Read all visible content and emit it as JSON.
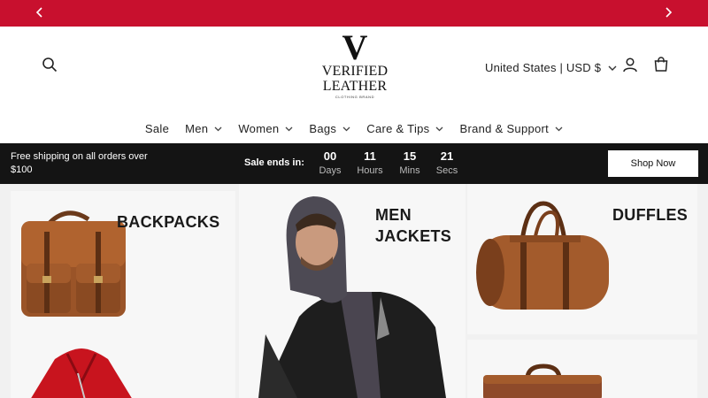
{
  "colors": {
    "announce_bg": "#c8102e",
    "promo_bg": "#141414"
  },
  "announcement": {
    "prev_icon": "chevron-left-icon",
    "next_icon": "chevron-right-icon"
  },
  "header": {
    "logo": {
      "letter": "V",
      "line1": "VERIFIED",
      "line2": "LEATHER",
      "tagline": "CLOTHING BRAND"
    },
    "locale_label": "United States | USD $",
    "icons": [
      "search-icon",
      "account-icon",
      "cart-icon"
    ]
  },
  "nav": {
    "items": [
      {
        "label": "Sale",
        "has_dropdown": false
      },
      {
        "label": "Men",
        "has_dropdown": true
      },
      {
        "label": "Women",
        "has_dropdown": true
      },
      {
        "label": "Bags",
        "has_dropdown": true
      },
      {
        "label": "Care & Tips",
        "has_dropdown": true
      },
      {
        "label": "Brand & Support",
        "has_dropdown": true
      }
    ]
  },
  "promo": {
    "shipping_text": "Free shipping on all orders over $100",
    "sale_ends_label": "Sale ends in:",
    "countdown": [
      {
        "value": "00",
        "unit": "Days"
      },
      {
        "value": "11",
        "unit": "Hours"
      },
      {
        "value": "15",
        "unit": "Mins"
      },
      {
        "value": "21",
        "unit": "Secs"
      }
    ],
    "shop_now_label": "Shop Now"
  },
  "categories": {
    "backpacks": "BACKPACKS",
    "men_jackets_line1": "MEN",
    "men_jackets_line2": "JACKETS",
    "duffles": "DUFFLES"
  }
}
